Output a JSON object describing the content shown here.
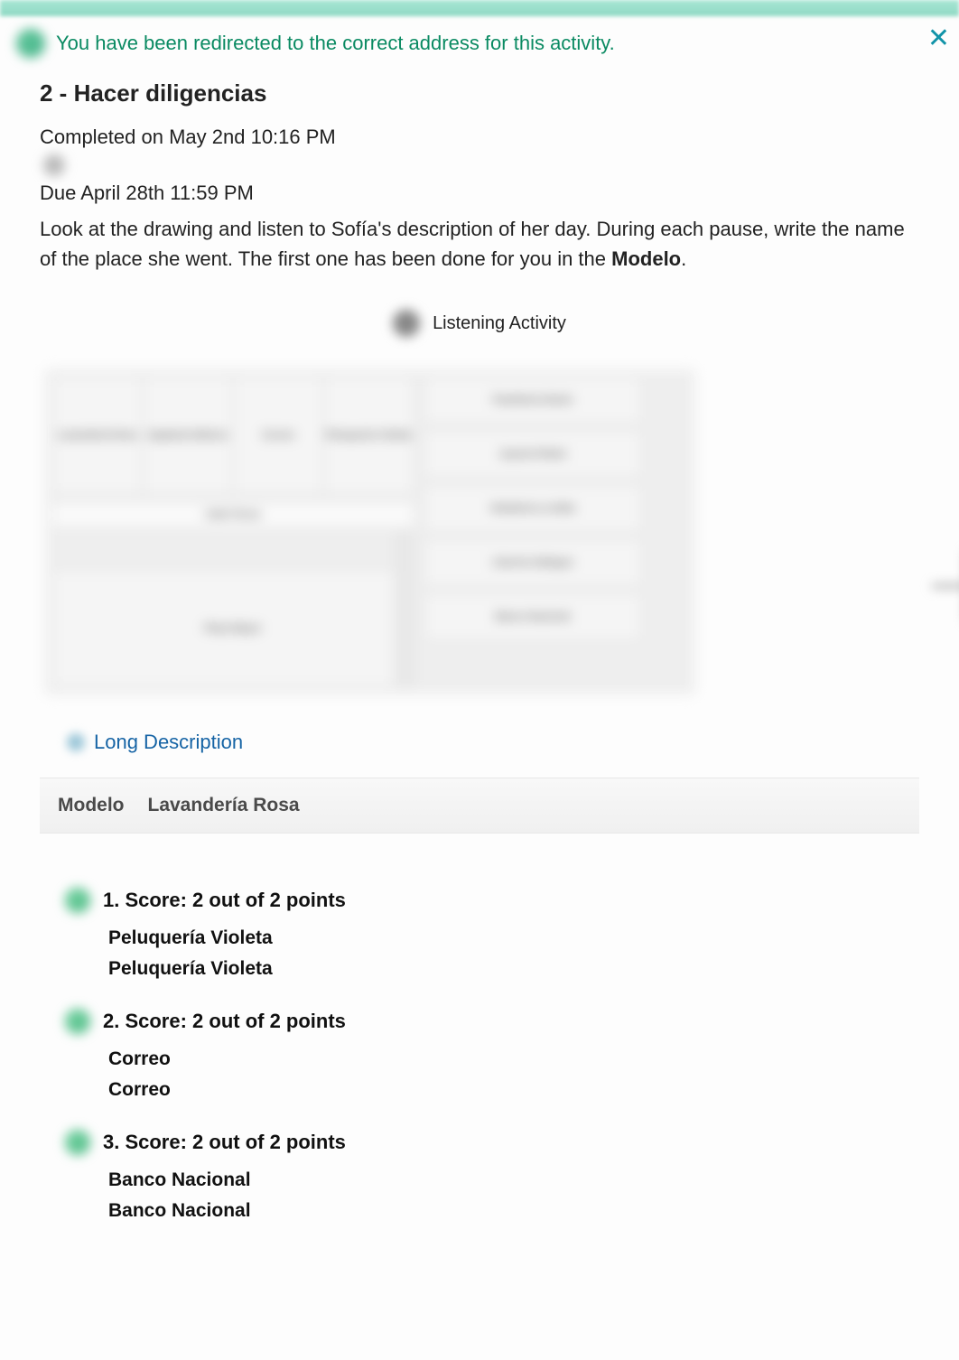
{
  "redirect_message": "You have been redirected to the correct address for this activity.",
  "close_glyph": "✕",
  "activity_title": "2 - Hacer diligencias",
  "completed_line": "Completed on May 2nd 10:16 PM",
  "due_line": "Due April 28th 11:59 PM",
  "instructions_pre": "Look at the drawing and listen to Sofía's description of her day. During each pause, write the name of the place she went. The first one has been done for you in the ",
  "instructions_bold": "Modelo",
  "instructions_post": ".",
  "listening_label": "Listening Activity",
  "map_labels": {
    "street": "Calle Flores",
    "plaza": "Plaza Mayor",
    "top": [
      "Lavandería Rosa",
      "Zapatería México",
      "Correo",
      "Peluquería Violeta"
    ],
    "side": [
      "Pastelería Simón",
      "Joyería Platón",
      "Heladería La Italia",
      "Librería Gallegos",
      "Banco Nacional"
    ]
  },
  "long_description_label": "Long Description",
  "modelo_label": "Modelo",
  "modelo_answer": "Lavandería Rosa",
  "answers": [
    {
      "head": "1. Score: 2 out of 2 points",
      "user": "Peluquería  Violeta",
      "correct": "Peluquería  Violeta"
    },
    {
      "head": "2. Score: 2 out of 2 points",
      "user": "Correo",
      "correct": "Correo"
    },
    {
      "head": "3. Score: 2 out of 2 points",
      "user": "Banco  Nacional",
      "correct": "Banco  Nacional"
    }
  ]
}
